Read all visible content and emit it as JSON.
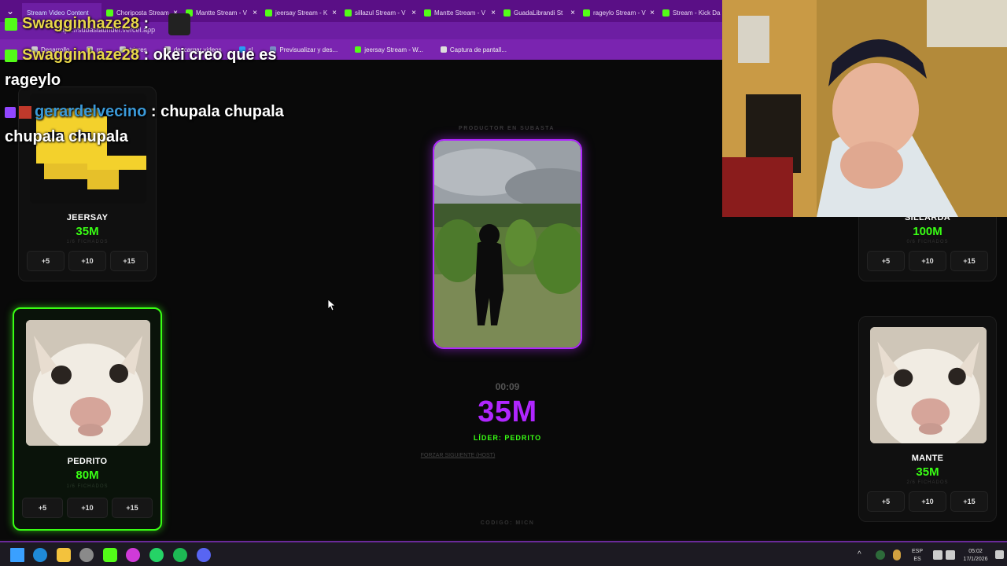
{
  "browser": {
    "tabs": [
      {
        "label": "Stream Video Content",
        "active": true
      },
      {
        "label": "Choriposta Stream"
      },
      {
        "label": "Mantte Stream - V"
      },
      {
        "label": "jeersay Stream - K"
      },
      {
        "label": "sillazul Stream - V"
      },
      {
        "label": "Mantte Stream - V"
      },
      {
        "label": "GuadaLibrandi St"
      },
      {
        "label": "rageylo Stream - V"
      },
      {
        "label": "Stream - Kick Da"
      }
    ],
    "url": "https://subastaunder.vercel.app",
    "bookmarks": [
      "Desarrollo",
      "rrr",
      "trigres",
      "descargar videos",
      "sl",
      "Previsualizar y des...",
      "jeersay Stream - W...",
      "Captura de pantall..."
    ]
  },
  "chat": {
    "messages": [
      {
        "user": "Swagginhaze28",
        "text": ":"
      },
      {
        "user": "Swagginhaze28",
        "text": ": okei creo que es",
        "cont": "rageylo"
      },
      {
        "user": "gerardelvecino",
        "text": ": chupala chupala",
        "cont": "chupala chupala"
      }
    ]
  },
  "auction": {
    "label": "PRODUCTOR EN SUBASTA",
    "timer": "00:09",
    "price": "35M",
    "leader": "LÍDER: PEDRITO",
    "force_next": "FORZAR SIGUIENTE (HOST)",
    "code": "CODIGO: MICN"
  },
  "bid_buttons": [
    "+5",
    "+10",
    "+15"
  ],
  "players": {
    "jeersay": {
      "name": "JEERSAY",
      "value": "35M",
      "fichados": "1/6 FICHADOS"
    },
    "sillarda": {
      "name": "SILLARDA",
      "value": "100M",
      "fichados": "0/6 FICHADOS"
    },
    "pedrito": {
      "name": "PEDRITO",
      "value": "80M",
      "fichados": "1/6 FICHADOS"
    },
    "mante": {
      "name": "MANTE",
      "value": "35M",
      "fichados": "2/6 FICHADOS"
    }
  },
  "taskbar": {
    "lang_top": "ESP",
    "lang_bottom": "ES",
    "time": "05:02",
    "date": "17/1/2026"
  },
  "colors": {
    "accent_purple": "#b026ff",
    "accent_green": "#39ff14",
    "chrome_purple": "#6d1ea3"
  }
}
